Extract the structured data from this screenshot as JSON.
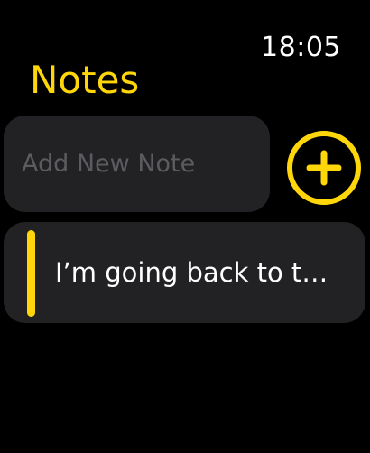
{
  "status": {
    "time": "18:05"
  },
  "header": {
    "title": "Notes"
  },
  "new_note": {
    "placeholder": "Add New Note",
    "add_icon": "plus-circle-icon"
  },
  "notes": [
    {
      "text": "I’m going back to t…"
    }
  ],
  "colors": {
    "accent": "#ffd60a",
    "background": "#000000",
    "card": "#222224",
    "placeholder": "#5c5c60",
    "text": "#ffffff"
  }
}
